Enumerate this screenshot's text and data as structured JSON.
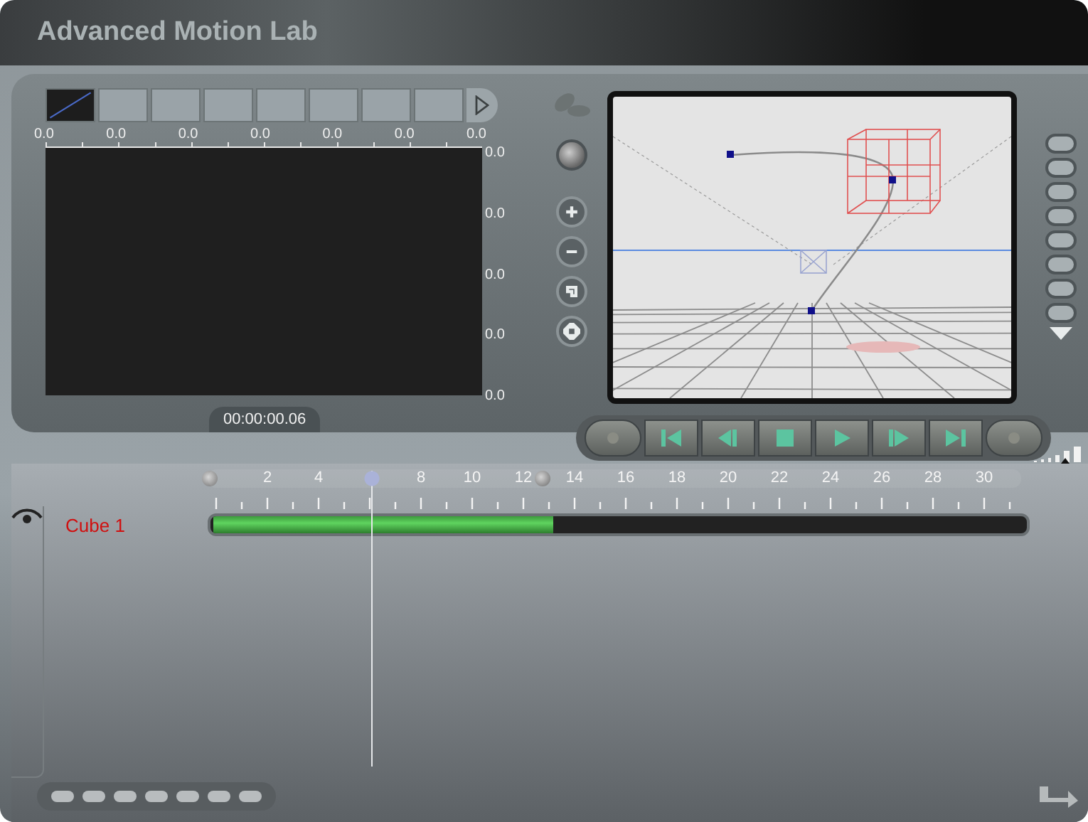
{
  "window": {
    "title": "Advanced Motion Lab"
  },
  "curve_editor": {
    "keyframe_thumbnails": [
      {
        "selected": true
      },
      {
        "selected": false
      },
      {
        "selected": false
      },
      {
        "selected": false
      },
      {
        "selected": false
      },
      {
        "selected": false
      },
      {
        "selected": false
      },
      {
        "selected": false
      }
    ],
    "x_ruler": [
      "0.0",
      "0.0",
      "0.0",
      "0.0",
      "0.0",
      "0.0",
      "0.0"
    ],
    "y_ruler": [
      "0.0",
      "0.0",
      "0.0",
      "0.0",
      "0.0"
    ],
    "timecode": "00:00:00.06"
  },
  "view_tools": [
    {
      "kind": "knob"
    },
    {
      "kind": "zoom-in"
    },
    {
      "kind": "zoom-out"
    },
    {
      "kind": "frame"
    },
    {
      "kind": "fit"
    }
  ],
  "transport": [
    {
      "kind": "record"
    },
    {
      "kind": "first"
    },
    {
      "kind": "step-back"
    },
    {
      "kind": "stop"
    },
    {
      "kind": "play"
    },
    {
      "kind": "step-forward"
    },
    {
      "kind": "last"
    },
    {
      "kind": "loop"
    }
  ],
  "timeline": {
    "labels": [
      "2",
      "4",
      "8",
      "10",
      "12",
      "14",
      "16",
      "18",
      "20",
      "22",
      "24",
      "26",
      "28",
      "30"
    ],
    "playhead": {
      "level": 0.19
    },
    "range_end": {
      "level": 0.41
    },
    "tracks": [
      {
        "name": "Cube 1",
        "level": 0.42
      }
    ]
  }
}
